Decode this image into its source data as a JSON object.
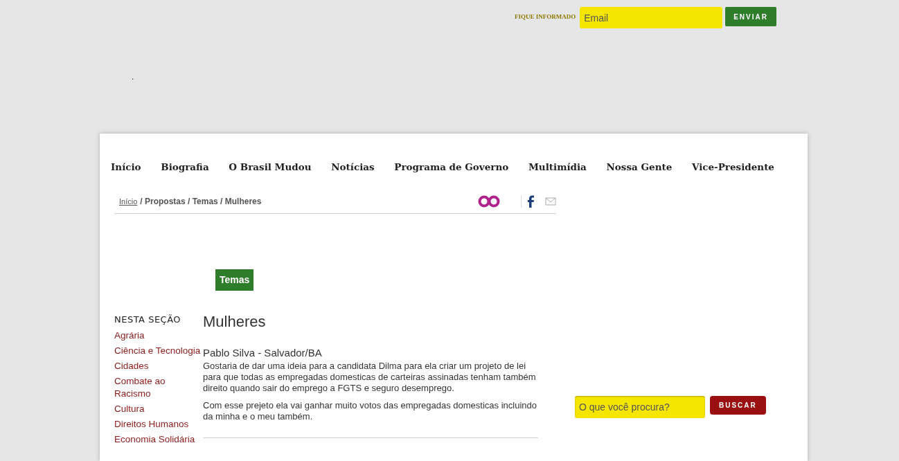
{
  "newsletter": {
    "label": "FIQUE INFORMADO",
    "placeholder": "Email",
    "button": "ENVIAR"
  },
  "stray_text": ".",
  "nav": [
    "Início",
    "Biografia",
    "O Brasil Mudou",
    "Notícias",
    "Programa de Governo",
    "Multimídia",
    "Nossa Gente",
    "Vice-Presidente"
  ],
  "breadcrumb": {
    "link": "Início",
    "rest": " / Propostas / Temas / Mulheres"
  },
  "section_button": "Temas",
  "sidebar": {
    "title": "NESTA SEÇÃO",
    "items": [
      "Agrária",
      "Ciência e Tecnologia",
      "Cidades",
      "Combate ao Racismo",
      "Cultura",
      "Direitos Humanos",
      "Economia Solidária"
    ]
  },
  "article": {
    "title": "Mulheres",
    "author": "Pablo Silva - Salvador/BA",
    "paragraphs": [
      "Gostaria de dar uma ideia para a candidata Dilma para ela criar um projeto de lei para que todas as empregadas domesticas de carteiras assinadas tenham também direito quando sair do emprego a FGTS e seguro desemprego.",
      "Com esse prejeto ela vai ganhar muito votos das empregadas domesticas incluindo da minha e o meu também."
    ]
  },
  "search": {
    "placeholder": "O que você procura?",
    "button": "BUSCAR"
  }
}
